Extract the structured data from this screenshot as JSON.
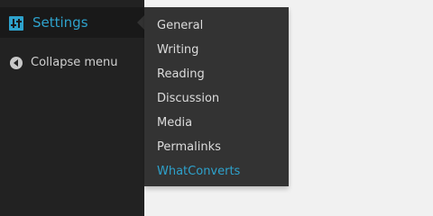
{
  "colors": {
    "sidebar_bg": "#222222",
    "submenu_bg": "#333333",
    "accent": "#2ea2cc",
    "page_bg": "#f1f1f1"
  },
  "sidebar": {
    "settings": {
      "label": "Settings",
      "icon": "settings-sliders-icon"
    },
    "collapse": {
      "label": "Collapse menu",
      "icon": "collapse-arrow-icon"
    }
  },
  "submenu": {
    "items": [
      {
        "label": "General"
      },
      {
        "label": "Writing"
      },
      {
        "label": "Reading"
      },
      {
        "label": "Discussion"
      },
      {
        "label": "Media"
      },
      {
        "label": "Permalinks"
      },
      {
        "label": "WhatConverts",
        "active": true
      }
    ]
  }
}
